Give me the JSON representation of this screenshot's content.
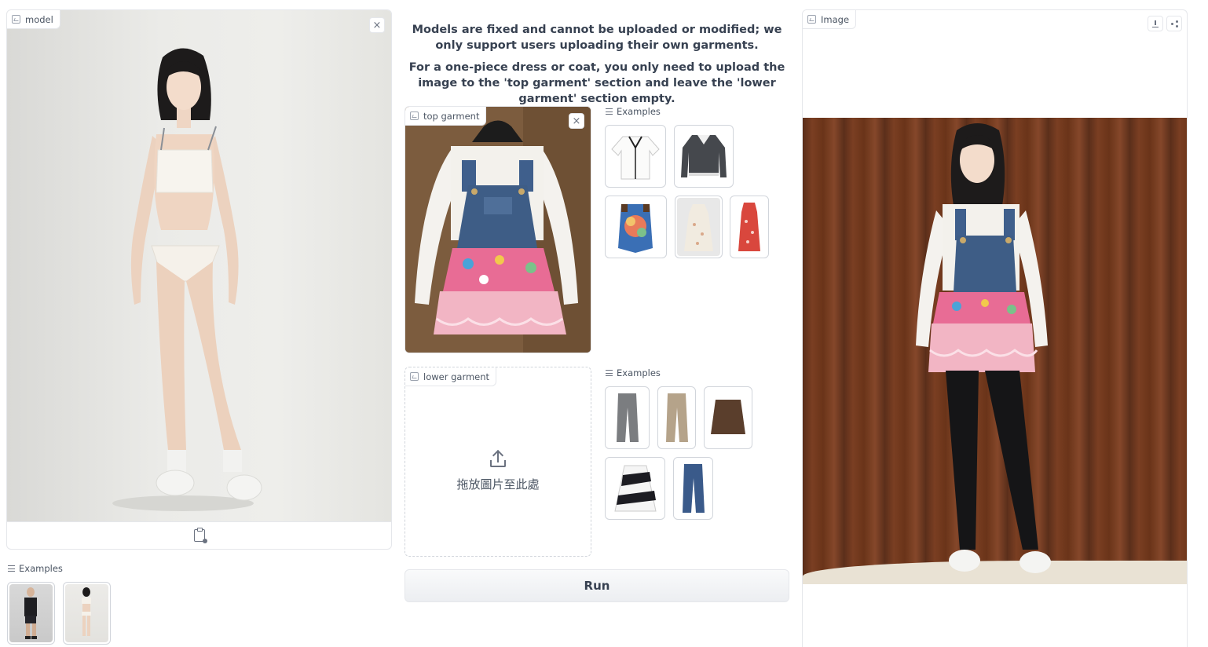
{
  "model_panel": {
    "label": "model",
    "close_symbol": "×",
    "bottom_icon": "clipboard-image-icon"
  },
  "model_examples": {
    "header": "Examples",
    "items": [
      "model-example-1",
      "model-example-2"
    ]
  },
  "info": {
    "line1": "Models are fixed and cannot be uploaded or modified; we only support users uploading their own garments.",
    "line2": "For a one-piece dress or coat, you only need to upload the image to the 'top garment' section and leave the 'lower garment' section empty."
  },
  "top_garment": {
    "label": "top garment",
    "close_symbol": "×"
  },
  "top_examples": {
    "header": "Examples",
    "items": [
      "white-blouse",
      "dark-cardigan",
      "floral-vest",
      "beige-floral-dress",
      "red-floral-dress"
    ]
  },
  "lower_garment": {
    "label": "lower garment",
    "upload_text": "拖放圖片至此處",
    "upload_icon": "upload-icon"
  },
  "lower_examples": {
    "header": "Examples",
    "items": [
      "grey-trousers",
      "khaki-trousers",
      "brown-skirt",
      "striped-skirt",
      "blue-jeans"
    ]
  },
  "run_label": "Run",
  "output_panel": {
    "label": "Image",
    "download_icon": "download-icon",
    "share_icon": "share-icon"
  }
}
